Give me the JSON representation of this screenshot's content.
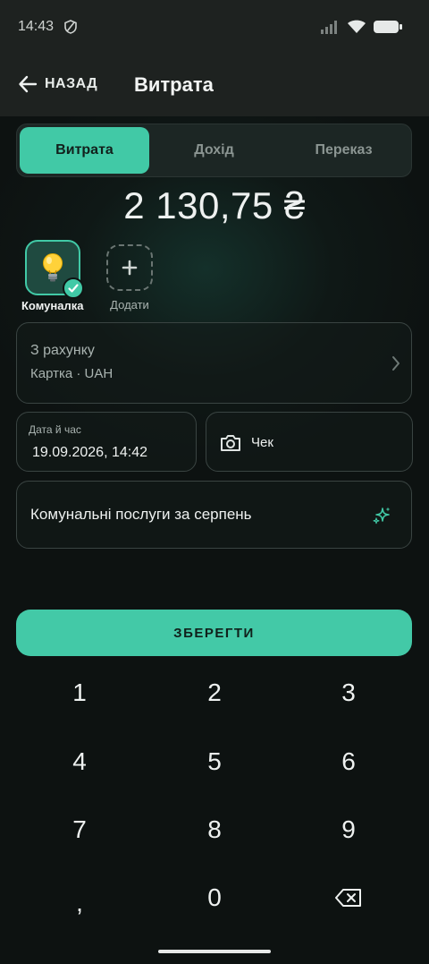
{
  "status_bar": {
    "time": "14:43"
  },
  "app_bar": {
    "back_label": "НАЗАД",
    "title": "Витрата"
  },
  "tabs": [
    {
      "label": "Витрата",
      "active": true
    },
    {
      "label": "Дохід",
      "active": false
    },
    {
      "label": "Переказ",
      "active": false
    }
  ],
  "amount": "2 130,75 ₴",
  "categories": {
    "selected": {
      "label": "Комуналка",
      "icon": "lightbulb-icon"
    },
    "add": {
      "label": "Додати",
      "icon": "plus-icon"
    }
  },
  "account": {
    "title": "З рахунку",
    "value": "Картка · UAH"
  },
  "datetime": {
    "label": "Дата й час",
    "value": "19.09.2026, 14:42"
  },
  "receipt": {
    "label": "Чек",
    "icon": "camera-icon"
  },
  "note": {
    "value": "Комунальні послуги за серпень",
    "icon": "sparkle-icon"
  },
  "save_label": "ЗБЕРЕГТИ",
  "keypad": [
    "1",
    "2",
    "3",
    "4",
    "5",
    "6",
    "7",
    "8",
    "9",
    ",",
    "0",
    "backspace"
  ],
  "colors": {
    "accent": "#41c9a6",
    "background": "#0f1413",
    "appbar": "#1e2220"
  }
}
